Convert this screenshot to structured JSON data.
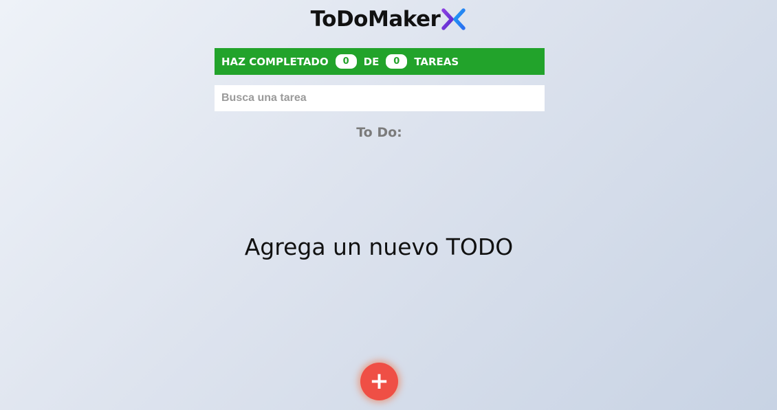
{
  "app": {
    "title": "ToDoMaker",
    "logo_icon": "double-chevron-x-logo",
    "logo_colors": [
      "#7b3fe4",
      "#2b8cf0"
    ]
  },
  "counter": {
    "prefix": "HAZ COMPLETADO",
    "completed": "0",
    "middle": "DE",
    "total": "0",
    "suffix": "TAREAS",
    "bar_color": "#22a32b"
  },
  "search": {
    "placeholder": "Busca una tarea",
    "value": ""
  },
  "list": {
    "title": "To Do:",
    "empty_message": "Agrega un nuevo TODO"
  },
  "fab": {
    "label": "+",
    "icon": "plus-icon",
    "color": "#ef4f45"
  }
}
